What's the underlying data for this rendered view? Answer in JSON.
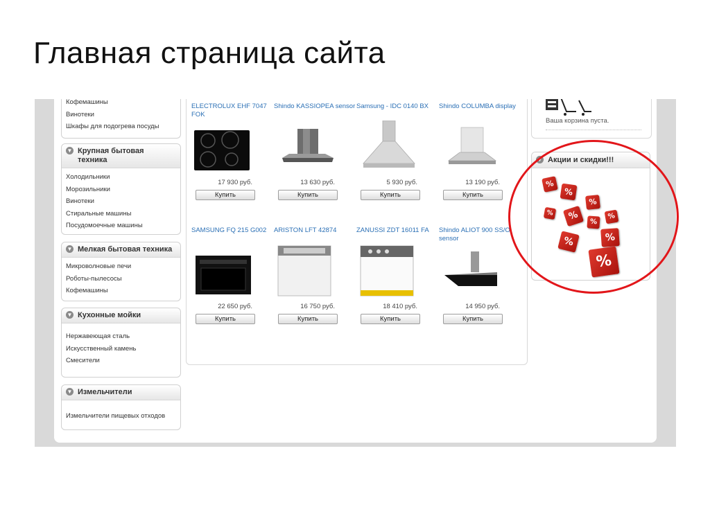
{
  "slide_title": "Главная страница сайта",
  "sidebar": {
    "top_items": [
      "Кофемашины",
      "Винотеки",
      "Шкафы для подогрева посуды"
    ],
    "categories": [
      {
        "title": "Крупная бытовая техника",
        "items": [
          "Холодильники",
          "Морозильники",
          "Винотеки",
          "Стиральные машины",
          "Посудомоечные машины"
        ]
      },
      {
        "title": "Мелкая бытовая техника",
        "items": [
          "Микроволновые печи",
          "Роботы-пылесосы",
          "Кофемашины"
        ]
      },
      {
        "title": "Кухонные мойки",
        "items": [
          "Нержавеющая сталь",
          "Искусственный камень",
          "Смесители"
        ]
      },
      {
        "title": "Измельчители",
        "items": [
          "Измельчители пищевых отходов"
        ]
      }
    ]
  },
  "products": [
    {
      "name": "ELECTROLUX EHF 7047 FOK",
      "price": "17 930 руб.",
      "buy": "Купить"
    },
    {
      "name": "Shindo KASSIOPEA sensor",
      "price": "13 630 руб.",
      "buy": "Купить"
    },
    {
      "name": "Samsung - IDC 0140 BX",
      "price": "5 930 руб.",
      "buy": "Купить"
    },
    {
      "name": "Shindo COLUMBA display",
      "price": "13 190 руб.",
      "buy": "Купить"
    },
    {
      "name": "SAMSUNG FQ 215 G002",
      "price": "22 650 руб.",
      "buy": "Купить"
    },
    {
      "name": "ARISTON LFT 42874",
      "price": "16 750 руб.",
      "buy": "Купить"
    },
    {
      "name": "ZANUSSI ZDT 16011 FA",
      "price": "18 410 руб.",
      "buy": "Купить"
    },
    {
      "name": "Shindo ALIOT 900 SS/O sensor",
      "price": "14 950 руб.",
      "buy": "Купить"
    }
  ],
  "cart": {
    "text": "Ваша корзина пуста."
  },
  "promo": {
    "title": "Акции и скидки!!!",
    "dice_symbol": "%"
  },
  "colors": {
    "link": "#2a6fb5",
    "highlight": "#e2161a",
    "dice": "#d42a20"
  }
}
